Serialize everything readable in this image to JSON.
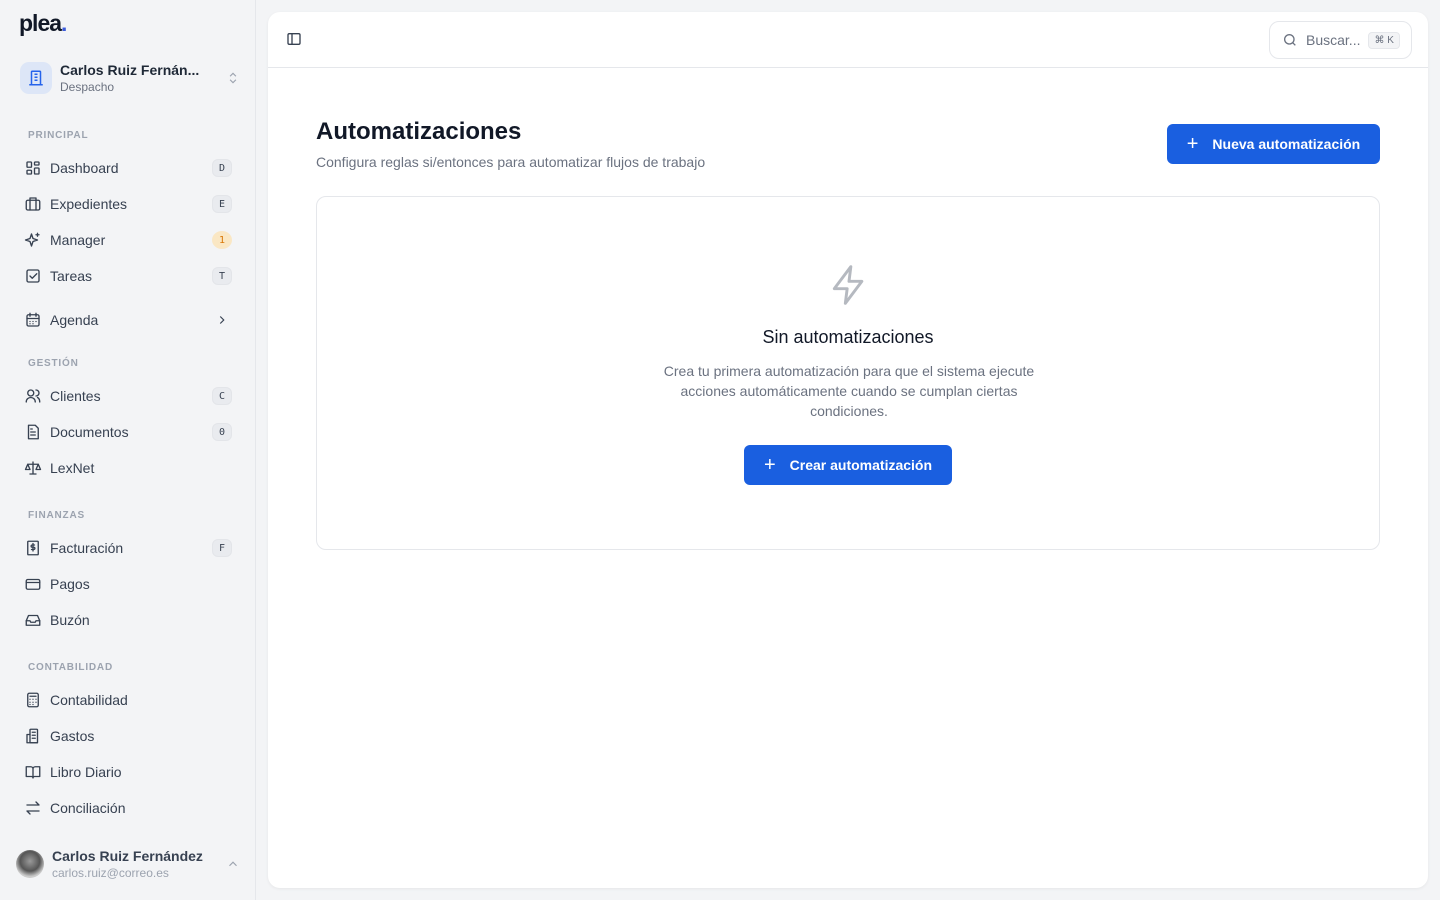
{
  "logo": "plea",
  "workspace": {
    "name": "Carlos Ruiz Fernán...",
    "type": "Despacho"
  },
  "sections": [
    {
      "title": "PRINCIPAL",
      "items": [
        {
          "label": "Dashboard",
          "icon": "dashboard-icon",
          "shortcut": "D"
        },
        {
          "label": "Expedientes",
          "icon": "briefcase-icon",
          "shortcut": "E"
        },
        {
          "label": "Manager",
          "icon": "sparkles-icon",
          "badge": "1"
        },
        {
          "label": "Tareas",
          "icon": "checkbox-icon",
          "shortcut": "T"
        },
        {
          "label": "Agenda",
          "icon": "calendar-icon",
          "chevron": true
        }
      ]
    },
    {
      "title": "GESTIÓN",
      "items": [
        {
          "label": "Clientes",
          "icon": "users-icon",
          "shortcut": "C"
        },
        {
          "label": "Documentos",
          "icon": "document-icon",
          "shortcut": "0"
        },
        {
          "label": "LexNet",
          "icon": "scale-icon"
        }
      ]
    },
    {
      "title": "FINANZAS",
      "items": [
        {
          "label": "Facturación",
          "icon": "invoice-icon",
          "shortcut": "F"
        },
        {
          "label": "Pagos",
          "icon": "credit-card-icon"
        },
        {
          "label": "Buzón",
          "icon": "inbox-icon"
        }
      ]
    },
    {
      "title": "CONTABILIDAD",
      "items": [
        {
          "label": "Contabilidad",
          "icon": "calculator-icon"
        },
        {
          "label": "Gastos",
          "icon": "receipt-icon"
        },
        {
          "label": "Libro Diario",
          "icon": "book-icon"
        },
        {
          "label": "Conciliación",
          "icon": "arrows-icon"
        }
      ]
    }
  ],
  "user": {
    "name": "Carlos Ruiz Fernández",
    "email": "carlos.ruiz@correo.es"
  },
  "search": {
    "placeholder": "Buscar...",
    "shortcut": "⌘ K"
  },
  "page": {
    "title": "Automatizaciones",
    "subtitle": "Configura reglas si/entonces para automatizar flujos de trabajo",
    "new_button": "Nueva automatización"
  },
  "empty": {
    "title": "Sin automatizaciones",
    "description": "Crea tu primera automatización para que el sistema ejecute acciones automáticamente cuando se cumplan ciertas condiciones.",
    "button": "Crear automatización"
  },
  "colors": {
    "accent": "#1a5fe0",
    "badge": "#fae7c4"
  }
}
